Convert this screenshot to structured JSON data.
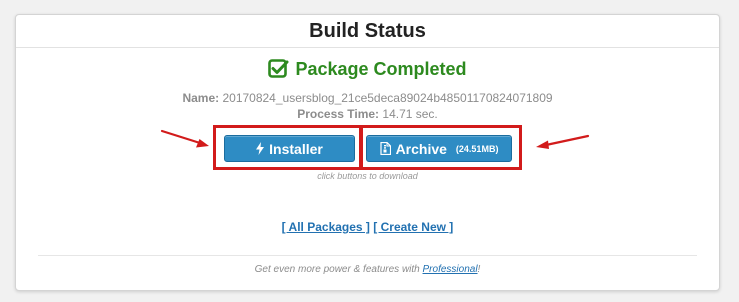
{
  "panel": {
    "title": "Build Status"
  },
  "status": {
    "text": "Package Completed",
    "icon": "check-square-icon",
    "color": "#2d8a1f"
  },
  "meta": {
    "name_label": "Name:",
    "name_value": "20170824_usersblog_21ce5deca89024b48501170824071809",
    "time_label": "Process Time:",
    "time_value": "14.71 sec."
  },
  "buttons": {
    "installer": {
      "label": "Installer",
      "icon": "lightning-bolt-icon"
    },
    "archive": {
      "label": "Archive",
      "size": "(24.51MB)",
      "icon": "file-archive-icon"
    },
    "hint": "click buttons to download",
    "accent": "#2e8cc4",
    "highlight": "#d21b1b"
  },
  "links": {
    "all_packages": "[ All Packages ]",
    "create_new": "[ Create New ]"
  },
  "footer": {
    "prefix": "Get even more power & features with ",
    "link": "Professional",
    "suffix": "!"
  }
}
